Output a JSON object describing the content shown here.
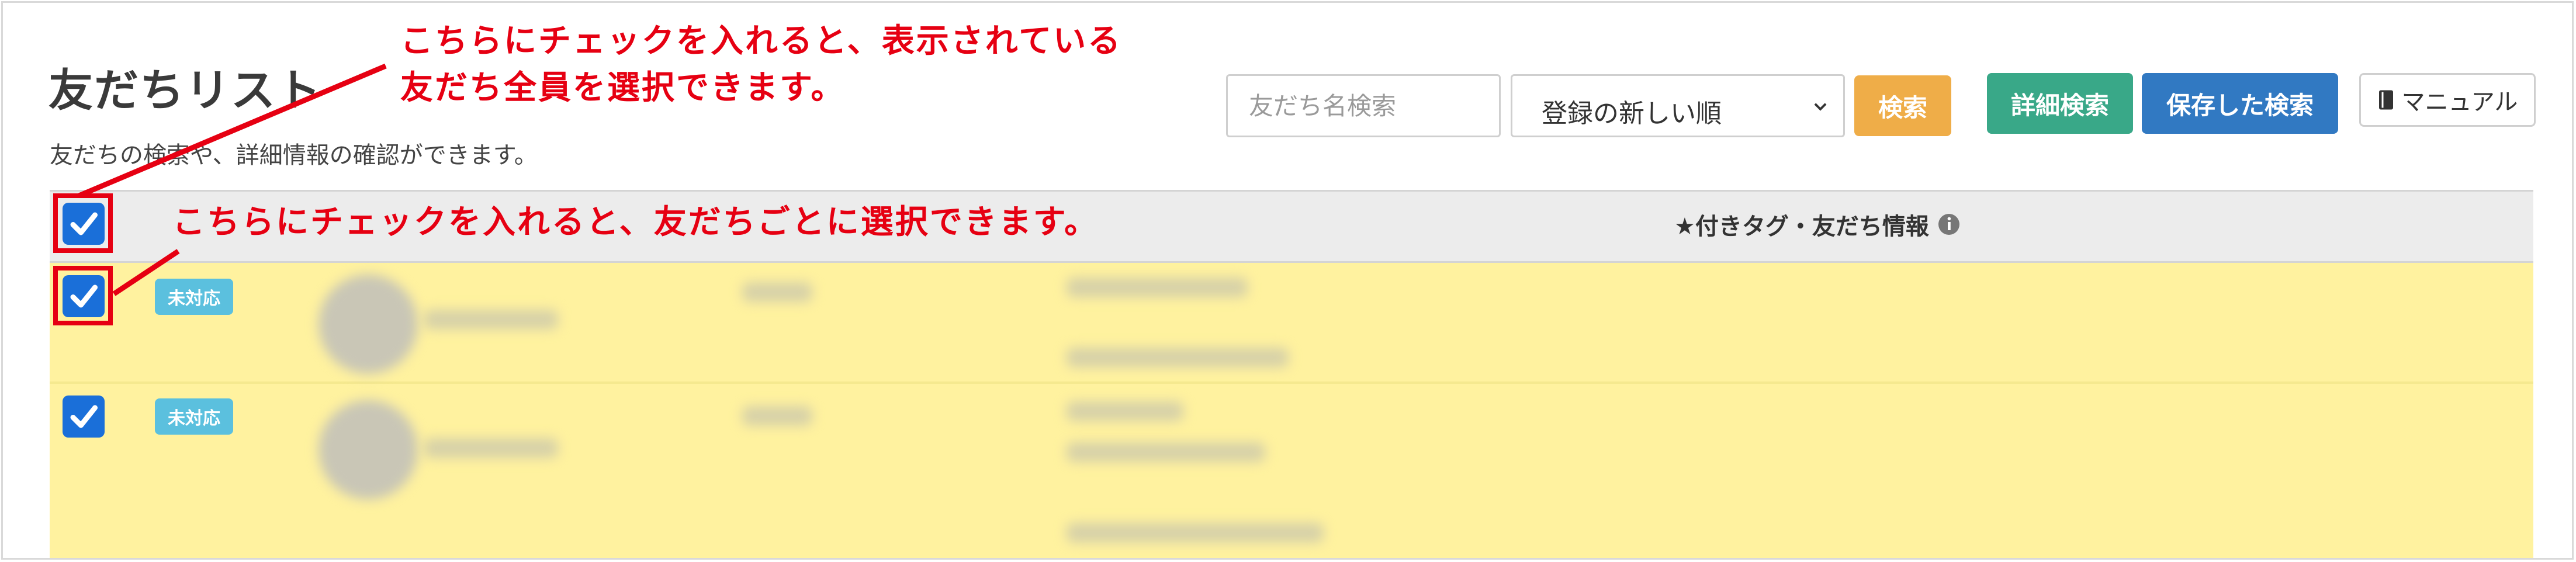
{
  "page": {
    "title": "友だちリスト",
    "subtitle": "友だちの検索や、詳細情報の確認ができます。"
  },
  "toolbar": {
    "search_placeholder": "友だち名検索",
    "sort_value": "登録の新しい順",
    "search_button": "検索",
    "detail_search_button": "詳細検索",
    "saved_search_button": "保存した検索",
    "manual_button": "マニュアル"
  },
  "table": {
    "column_tag_info": "★付きタグ・友だち情報",
    "rows": [
      {
        "status": "未対応",
        "checked": true
      },
      {
        "status": "未対応",
        "checked": true
      }
    ]
  },
  "annotations": {
    "select_all": [
      "こちらにチェックを入れると、表示されている",
      "友だち全員を選択できます。"
    ],
    "select_each": "こちらにチェックを入れると、友だちごとに選択できます。"
  },
  "colors": {
    "annotation_red": "#e60012",
    "checkbox_blue": "#1a6fd9",
    "row_highlight": "#fff29f",
    "badge_blue": "#5bc0de",
    "search_orange": "#efad48",
    "detail_green": "#39a888",
    "saved_blue": "#3179c2"
  },
  "icons": {
    "checkbox": "check-icon",
    "sort": "chevron-down-icon",
    "manual": "book-icon",
    "info": "info-icon"
  }
}
